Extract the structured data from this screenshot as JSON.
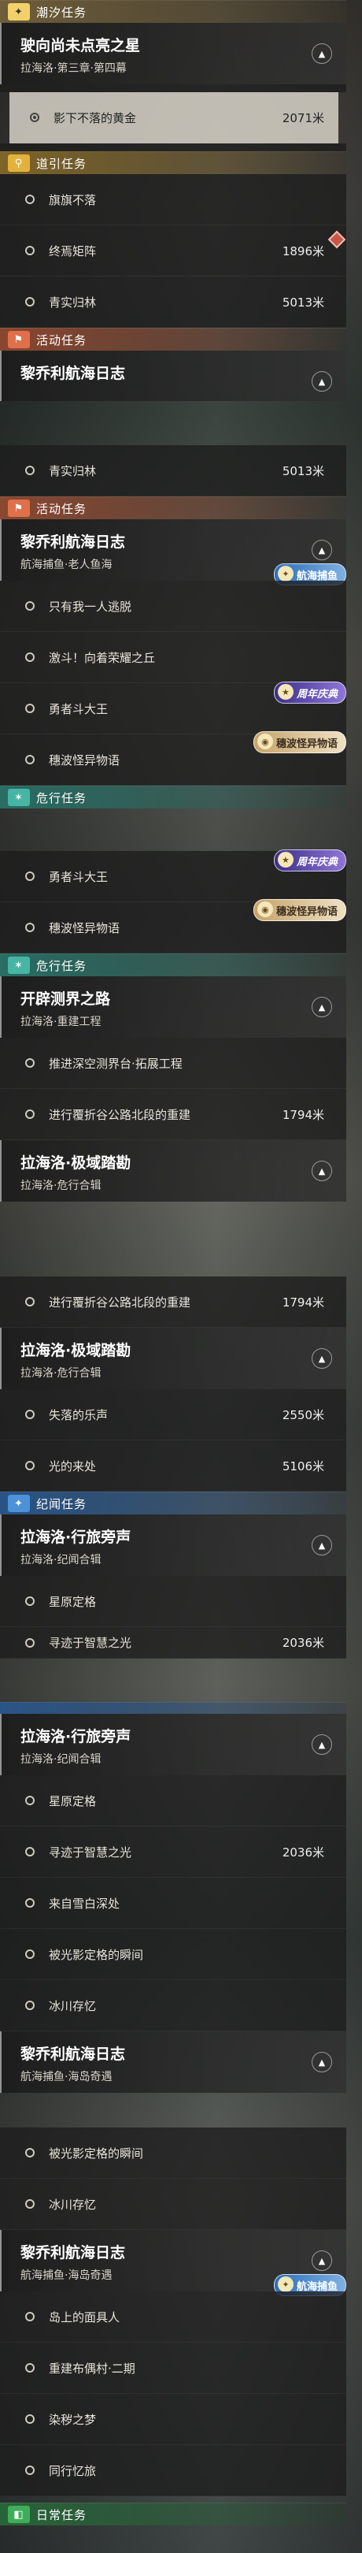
{
  "icons": {
    "tide": "✦",
    "guide": "⚲",
    "event": "⚑",
    "danger": "✶",
    "note": "✦",
    "daily": "◧",
    "chevron": "chevron-up-icon",
    "marker": "diamond-icon"
  },
  "labels": {
    "tide": "潮汐任务",
    "guide": "道引任务",
    "event": "活动任务",
    "danger": "危行任务",
    "note": "纪闻任务",
    "daily": "日常任务"
  },
  "badges": {
    "fishing": "航海捕鱼",
    "anniv": "周年庆典",
    "wave": "穗波怪异物语"
  },
  "quests": {
    "xingxiang": {
      "title": "驶向尚未点亮之星",
      "sub": "拉海洛·第三章·第四幕"
    },
    "journal": {
      "title": "黎乔利航海日志"
    },
    "journal_fish": {
      "title": "黎乔利航海日志",
      "sub": "航海捕鱼·老人鱼海"
    },
    "journal_fish2": {
      "title": "黎乔利航海日志",
      "sub": "航海捕鱼·海岛奇遇"
    },
    "kaipi": {
      "title": "开辟测界之路",
      "sub": "拉海洛·重建工程"
    },
    "jiyu": {
      "title": "拉海洛·极域踏勘",
      "sub": "拉海洛·危行合辑"
    },
    "xinglv": {
      "title": "拉海洛·行旅旁声",
      "sub": "拉海洛·纪闻合辑"
    }
  },
  "objectives": {
    "yingxia": {
      "label": "影下不落的黄金",
      "dist": "2071米"
    },
    "qiyu": {
      "label": "旗旗不落"
    },
    "zhongyan": {
      "label": "终焉矩阵",
      "dist": "1896米"
    },
    "qingshi": {
      "label": "青实归林",
      "dist": "5013米"
    },
    "zhiyou": {
      "label": "只有我一人逃脱"
    },
    "jinan": {
      "label": "激斗！向着荣耀之丘"
    },
    "yongzhe": {
      "label": "勇者斗大王"
    },
    "suibo": {
      "label": "穗波怪异物语"
    },
    "tuijin": {
      "label": "推进深空测界台·拓展工程"
    },
    "jinxing": {
      "label": "进行覆折谷公路北段的重建",
      "dist": "1794米"
    },
    "shiluo": {
      "label": "失落的乐声",
      "dist": "2550米"
    },
    "guang": {
      "label": "光的来处",
      "dist": "5106米"
    },
    "xingyuan": {
      "label": "星原定格"
    },
    "xunji": {
      "label": "寻迹于智慧之光",
      "dist": "2036米"
    },
    "laizi": {
      "label": "来自雪白深处"
    },
    "beiguang": {
      "label": "被光影定格的瞬间"
    },
    "bingchuan": {
      "label": "冰川存忆"
    },
    "daoshang": {
      "label": "岛上的面具人"
    },
    "chongjian": {
      "label": "重建布偶村·二期"
    },
    "ranyi": {
      "label": "染秽之梦"
    },
    "tongxing": {
      "label": "同行忆旅"
    }
  }
}
